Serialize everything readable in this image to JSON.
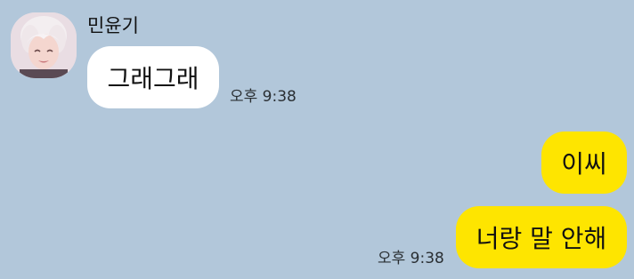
{
  "conversation": {
    "incoming": {
      "sender_name": "민윤기",
      "avatar_icon": "profile-photo-avatar",
      "messages": [
        {
          "text": "그래그래",
          "time": "오후 9:38"
        }
      ]
    },
    "outgoing": {
      "messages": [
        {
          "text": "이씨"
        },
        {
          "text": "너랑 말 안해",
          "time": "오후 9:38"
        }
      ]
    }
  },
  "colors": {
    "background": "#B2C7DA",
    "incoming_bubble": "#FFFFFF",
    "outgoing_bubble": "#FEE500",
    "text": "#111111",
    "timestamp": "#2A2F33"
  }
}
